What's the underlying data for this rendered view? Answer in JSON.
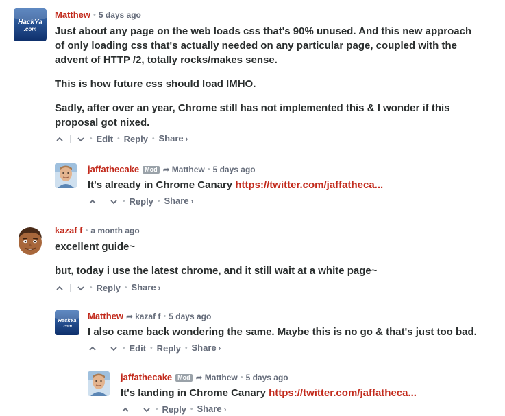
{
  "comments": [
    {
      "author": "Matthew",
      "time": "5 days ago",
      "paragraphs": [
        "Just about any page on the web loads css that's 90% unused. And this new approach of only loading css that's actually needed on any particular page, coupled with the advent of HTTP /2, totally rocks/makes sense.",
        "This is how future css should load IMHO.",
        "Sadly, after over an year, Chrome still has not implemented this & I wonder if this proposal got nixed."
      ],
      "actions": {
        "edit": "Edit",
        "reply": "Reply",
        "share": "Share"
      }
    },
    {
      "author": "jaffathecake",
      "badge": "Mod",
      "reply_to": "Matthew",
      "time": "5 days ago",
      "text_prefix": "It's already in Chrome Canary ",
      "link": "https://twitter.com/jaffatheca...",
      "actions": {
        "reply": "Reply",
        "share": "Share"
      }
    },
    {
      "author": "kazaf f",
      "time": "a month ago",
      "paragraphs": [
        "excellent guide~",
        "but, today i use the latest chrome, and it still wait at a white page~"
      ],
      "actions": {
        "reply": "Reply",
        "share": "Share"
      }
    },
    {
      "author": "Matthew",
      "reply_to": "kazaf f",
      "time": "5 days ago",
      "paragraphs": [
        "I also came back wondering the same. Maybe this is no go & that's just too bad."
      ],
      "actions": {
        "edit": "Edit",
        "reply": "Reply",
        "share": "Share"
      }
    },
    {
      "author": "jaffathecake",
      "badge": "Mod",
      "reply_to": "Matthew",
      "time": "5 days ago",
      "text_prefix": "It's landing in Chrome Canary ",
      "link": "https://twitter.com/jaffatheca...",
      "actions": {
        "reply": "Reply",
        "share": "Share"
      }
    }
  ],
  "avatars": {
    "hackya_text_1": "HackYa",
    "hackya_text_2": ".com"
  },
  "icons": {
    "upvote": "chevron-up-icon",
    "downvote": "chevron-down-icon",
    "reply_arrow": "reply-arrow-icon",
    "share_chevron": "chevron-right-icon"
  },
  "colors": {
    "author": "#c22a1c",
    "link": "#c22a1c",
    "text": "#2a2e2e",
    "muted": "#656c7a",
    "mod_badge": "#9aa2a9"
  }
}
